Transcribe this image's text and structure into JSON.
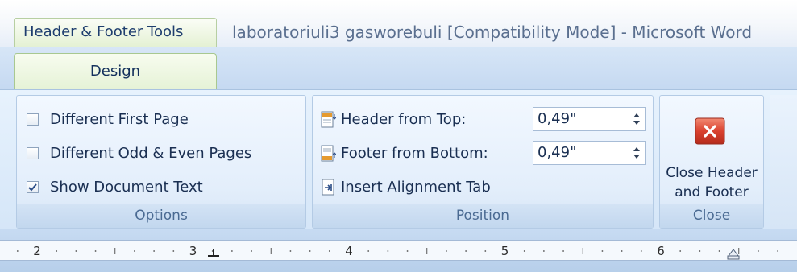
{
  "title_bar": {
    "context_tab": "Header & Footer Tools",
    "document_title": "laboratoriuli3 gasworebuli [Compatibility Mode] - Microsoft Word"
  },
  "tabs": [
    {
      "label": "Design",
      "active": true
    }
  ],
  "groups": {
    "options": {
      "label": "Options",
      "items": [
        {
          "label": "Different First Page",
          "checked": false
        },
        {
          "label": "Different Odd & Even Pages",
          "checked": false
        },
        {
          "label": "Show Document Text",
          "checked": true
        }
      ]
    },
    "position": {
      "label": "Position",
      "header_from_top": {
        "label": "Header from Top:",
        "value": "0,49\""
      },
      "footer_from_bottom": {
        "label": "Footer from Bottom:",
        "value": "0,49\""
      },
      "insert_alignment_tab": "Insert Alignment Tab"
    },
    "close": {
      "label": "Close",
      "button_line1": "Close Header",
      "button_line2": "and Footer"
    }
  },
  "ruler": {
    "numbers": [
      "2",
      "3",
      "4",
      "5",
      "6"
    ]
  },
  "colors": {
    "accent_green": "#e5f2d6",
    "ribbon_blue": "#d5e6f8",
    "close_red": "#d9412f"
  }
}
